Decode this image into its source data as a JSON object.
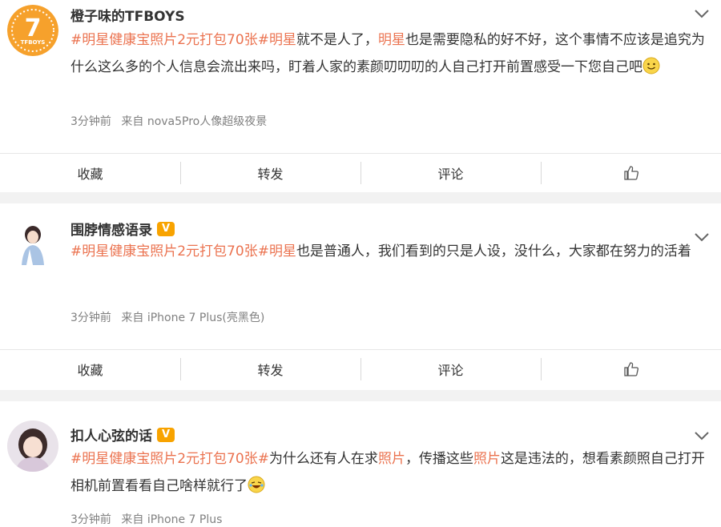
{
  "posts": [
    {
      "username": "橙子味的TFBOYS",
      "verified": false,
      "avatar_text": "TFBOYS",
      "content": [
        {
          "t": "tag",
          "v": "#明星健康宝照片2元打包70张#"
        },
        {
          "t": "kw",
          "v": "明星"
        },
        {
          "t": "text",
          "v": "就不是人了，"
        },
        {
          "t": "kw",
          "v": "明星"
        },
        {
          "t": "text",
          "v": "也是需要隐私的好不好，这个事情不应该是追究为什么这么多的个人信息会流出来吗，盯着人家的素颜叨叨叨的人自己打开前置感受一下您自己吧"
        },
        {
          "t": "emoji",
          "v": "smile-emoji"
        }
      ],
      "time": "3分钟前",
      "source": "来自 nova5Pro人像超级夜景",
      "actions": {
        "collect": "收藏",
        "repost": "转发",
        "comment": "评论",
        "like_icon": "thumb-up-icon"
      }
    },
    {
      "username": "围脖情感语录",
      "verified": true,
      "verified_badge": "V",
      "content": [
        {
          "t": "tag",
          "v": "#明星健康宝照片2元打包70张#"
        },
        {
          "t": "kw",
          "v": "明星"
        },
        {
          "t": "text",
          "v": "也是普通人，我们看到的只是人设，没什么，大家都在努力的活着"
        }
      ],
      "time": "3分钟前",
      "source": "来自 iPhone 7 Plus(亮黑色)",
      "actions": {
        "collect": "收藏",
        "repost": "转发",
        "comment": "评论",
        "like_icon": "thumb-up-icon"
      }
    },
    {
      "username": "扣人心弦的话",
      "verified": true,
      "verified_badge": "V",
      "content": [
        {
          "t": "tag",
          "v": "#明星健康宝照片2元打包70张#"
        },
        {
          "t": "text",
          "v": "为什么还有人在求"
        },
        {
          "t": "kw",
          "v": "照片"
        },
        {
          "t": "text",
          "v": "，传播这些"
        },
        {
          "t": "kw",
          "v": "照片"
        },
        {
          "t": "text",
          "v": "这是违法的，想看素颜照自己打开相机前置看看自己啥样就行了"
        },
        {
          "t": "emoji",
          "v": "laugh-cry-emoji"
        }
      ],
      "time": "3分钟前",
      "source": "来自 iPhone 7 Plus"
    }
  ],
  "colors": {
    "accent": "#eb7350",
    "badge": "#f8a300",
    "meta": "#808080",
    "divider": "#f2f2f2"
  }
}
